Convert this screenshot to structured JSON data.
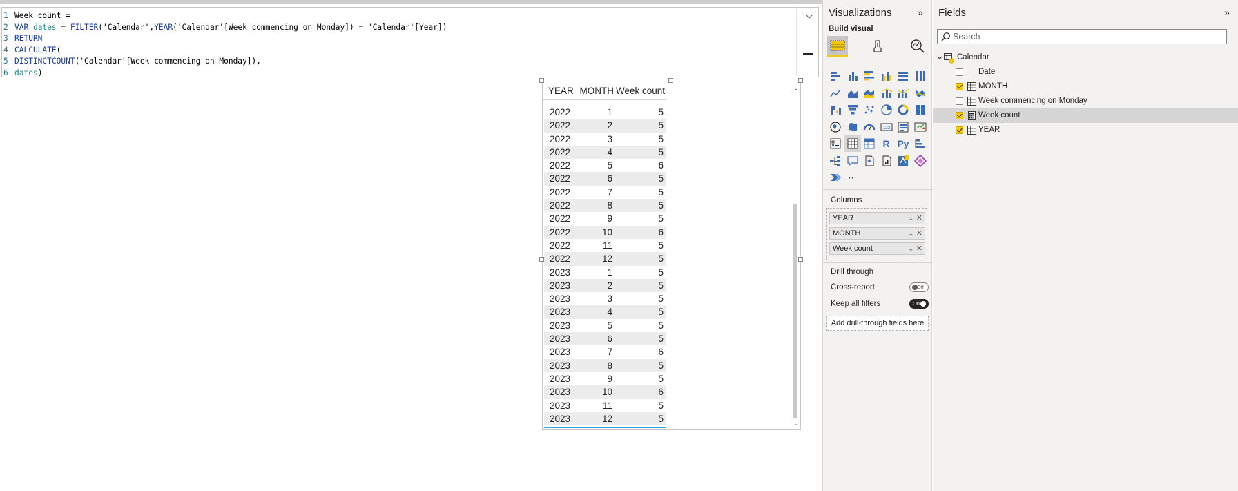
{
  "dax": {
    "lines": [
      {
        "num": "1",
        "parts": [
          {
            "t": "Week count =",
            "c": "plain"
          }
        ]
      },
      {
        "num": "2",
        "parts": [
          {
            "t": "VAR ",
            "c": "kw"
          },
          {
            "t": "dates",
            "c": "var"
          },
          {
            "t": " = ",
            "c": "plain"
          },
          {
            "t": "FILTER",
            "c": "fn"
          },
          {
            "t": "('Calendar',",
            "c": "plain"
          },
          {
            "t": "YEAR",
            "c": "fn"
          },
          {
            "t": "('Calendar'[Week commencing on Monday]) = 'Calendar'[Year])",
            "c": "plain"
          }
        ]
      },
      {
        "num": "3",
        "parts": [
          {
            "t": "RETURN",
            "c": "kw"
          }
        ]
      },
      {
        "num": "4",
        "parts": [
          {
            "t": "CALCULATE",
            "c": "fn"
          },
          {
            "t": "(",
            "c": "plain"
          }
        ]
      },
      {
        "num": "5",
        "parts": [
          {
            "t": "DISTINCTCOUNT",
            "c": "fn"
          },
          {
            "t": "('Calendar'[Week commencing on Monday]),",
            "c": "plain"
          }
        ]
      },
      {
        "num": "6",
        "parts": [
          {
            "t": "dates",
            "c": "var"
          },
          {
            "t": ")",
            "c": "plain"
          }
        ]
      }
    ]
  },
  "table": {
    "headers": {
      "year": "YEAR",
      "month": "MONTH",
      "week_count": "Week count"
    },
    "rows": [
      [
        "2022",
        "1",
        "5"
      ],
      [
        "2022",
        "2",
        "5"
      ],
      [
        "2022",
        "3",
        "5"
      ],
      [
        "2022",
        "4",
        "5"
      ],
      [
        "2022",
        "5",
        "6"
      ],
      [
        "2022",
        "6",
        "5"
      ],
      [
        "2022",
        "7",
        "5"
      ],
      [
        "2022",
        "8",
        "5"
      ],
      [
        "2022",
        "9",
        "5"
      ],
      [
        "2022",
        "10",
        "6"
      ],
      [
        "2022",
        "11",
        "5"
      ],
      [
        "2022",
        "12",
        "5"
      ],
      [
        "2023",
        "1",
        "5"
      ],
      [
        "2023",
        "2",
        "5"
      ],
      [
        "2023",
        "3",
        "5"
      ],
      [
        "2023",
        "4",
        "5"
      ],
      [
        "2023",
        "5",
        "5"
      ],
      [
        "2023",
        "6",
        "5"
      ],
      [
        "2023",
        "7",
        "6"
      ],
      [
        "2023",
        "8",
        "5"
      ],
      [
        "2023",
        "9",
        "5"
      ],
      [
        "2023",
        "10",
        "6"
      ],
      [
        "2023",
        "11",
        "5"
      ],
      [
        "2023",
        "12",
        "5"
      ]
    ]
  },
  "visualizations": {
    "title": "Visualizations",
    "collapse_glyph": "»",
    "build_visual": "Build visual",
    "columns_label": "Columns",
    "columns": [
      "YEAR",
      "MONTH",
      "Week count"
    ],
    "drill_through": "Drill through",
    "cross_report": {
      "label": "Cross-report",
      "state": "Off"
    },
    "keep_all_filters": {
      "label": "Keep all filters",
      "state": "On"
    },
    "add_drill": "Add drill-through fields here",
    "more": "···",
    "text_icons": {
      "r": "R",
      "py": "Py",
      "num": "123"
    }
  },
  "fields": {
    "title": "Fields",
    "collapse_glyph": "»",
    "search_placeholder": "Search",
    "table_name": "Calendar",
    "items": [
      {
        "label": "Date",
        "checked": false,
        "icon": "none"
      },
      {
        "label": "MONTH",
        "checked": true,
        "icon": "table-column-icon"
      },
      {
        "label": "Week commencing on Monday",
        "checked": false,
        "icon": "table-column-icon"
      },
      {
        "label": "Week count",
        "checked": true,
        "icon": "calculator-icon"
      },
      {
        "label": "YEAR",
        "checked": true,
        "icon": "table-column-icon"
      }
    ]
  },
  "colors": {
    "accent": "#f2c811",
    "viz_blue": "#3b6cb5",
    "total_line": "#33a0d8"
  }
}
